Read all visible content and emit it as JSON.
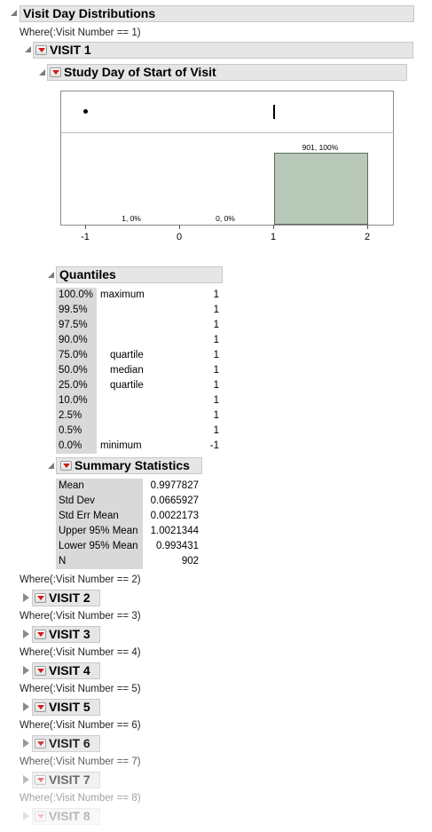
{
  "report": {
    "title": "Visit Day Distributions",
    "where_visit1": "Where(:Visit Number == 1)"
  },
  "visit1": {
    "title": "VISIT 1",
    "subtitle": "Study Day of Start of Visit"
  },
  "histogram": {
    "axis_ticks": [
      "-1",
      "0",
      "1",
      "2"
    ],
    "bar_labels": [
      "1, 0%",
      "0, 0%",
      "901, 100%"
    ],
    "bar_color": "#b9c9b9"
  },
  "chart_data": {
    "type": "bar",
    "title": "Study Day of Start of Visit",
    "categories": [
      "-1 to 0",
      "0 to 1",
      "1 to 2"
    ],
    "values": [
      1,
      0,
      901
    ],
    "labels": [
      "1, 0%",
      "0, 0%",
      "901, 100%"
    ],
    "xlim": [
      -1,
      2
    ],
    "xticks": [
      -1,
      0,
      1,
      2
    ],
    "outlier_box_plot": {
      "outlier_points": [
        -1
      ],
      "box_value": 1
    }
  },
  "quantiles": {
    "title": "Quantiles",
    "rows": [
      {
        "pct": "100.0%",
        "label": "maximum",
        "value": "1"
      },
      {
        "pct": "99.5%",
        "label": "",
        "value": "1"
      },
      {
        "pct": "97.5%",
        "label": "",
        "value": "1"
      },
      {
        "pct": "90.0%",
        "label": "",
        "value": "1"
      },
      {
        "pct": "75.0%",
        "label": "quartile",
        "value": "1"
      },
      {
        "pct": "50.0%",
        "label": "median",
        "value": "1"
      },
      {
        "pct": "25.0%",
        "label": "quartile",
        "value": "1"
      },
      {
        "pct": "10.0%",
        "label": "",
        "value": "1"
      },
      {
        "pct": "2.5%",
        "label": "",
        "value": "1"
      },
      {
        "pct": "0.5%",
        "label": "",
        "value": "1"
      },
      {
        "pct": "0.0%",
        "label": "minimum",
        "value": "-1"
      }
    ]
  },
  "summary": {
    "title": "Summary Statistics",
    "rows": [
      {
        "label": "Mean",
        "value": "0.9977827"
      },
      {
        "label": "Std Dev",
        "value": "0.0665927"
      },
      {
        "label": "Std Err Mean",
        "value": "0.0022173"
      },
      {
        "label": "Upper 95% Mean",
        "value": "1.0021344"
      },
      {
        "label": "Lower 95% Mean",
        "value": "0.993431"
      },
      {
        "label": "N",
        "value": "902"
      }
    ]
  },
  "collapsed_visits": [
    {
      "where": "Where(:Visit Number == 2)",
      "title": "VISIT 2"
    },
    {
      "where": "Where(:Visit Number == 3)",
      "title": "VISIT 3"
    },
    {
      "where": "Where(:Visit Number == 4)",
      "title": "VISIT 4"
    },
    {
      "where": "Where(:Visit Number == 5)",
      "title": "VISIT 5"
    },
    {
      "where": "Where(:Visit Number == 6)",
      "title": "VISIT 6"
    },
    {
      "where": "Where(:Visit Number == 7)",
      "title": "VISIT 7"
    },
    {
      "where": "Where(:Visit Number == 8)",
      "title": "VISIT 8"
    }
  ]
}
